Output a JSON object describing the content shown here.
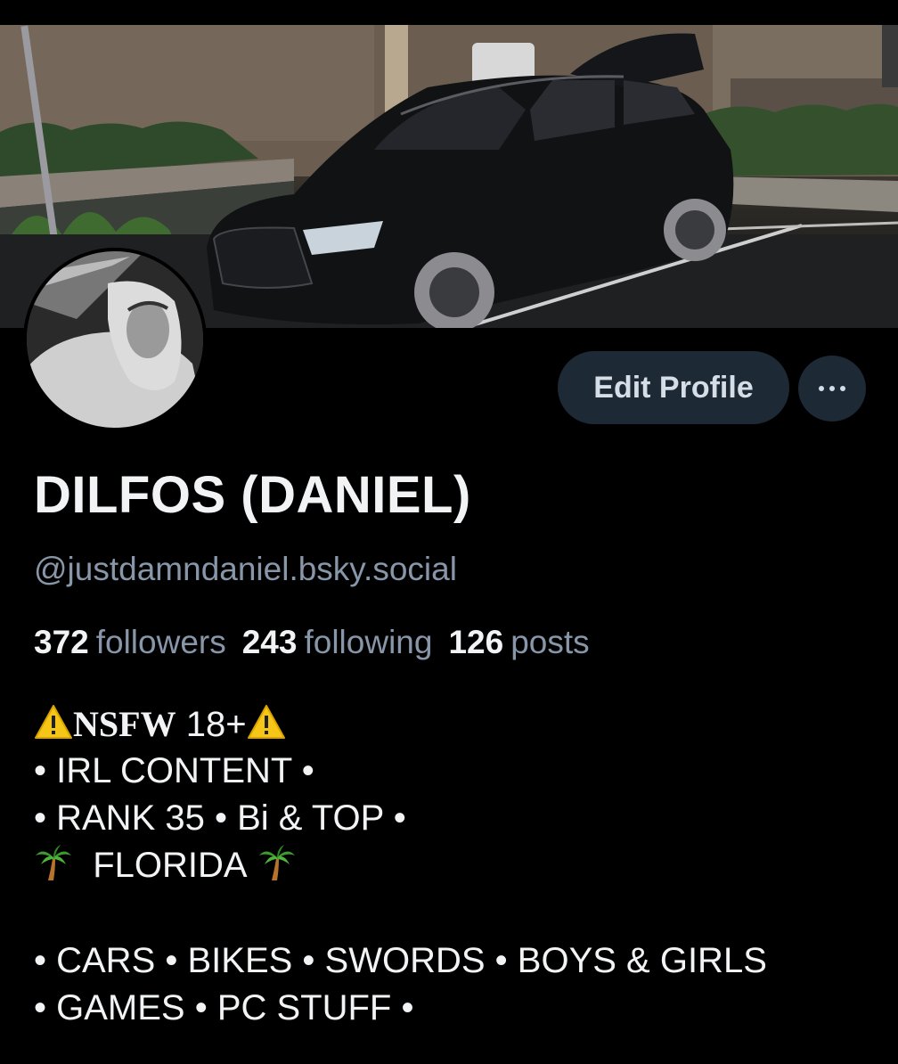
{
  "profile": {
    "display_name": "DILFOS (DANIEL)",
    "handle": "@justdamndaniel.bsky.social",
    "edit_button_label": "Edit Profile",
    "banner_description": "black-sedan-banner",
    "avatar_description": "hoodie-selfie-avatar"
  },
  "stats": [
    {
      "count": "372",
      "label": "followers"
    },
    {
      "count": "243",
      "label": "following"
    },
    {
      "count": "126",
      "label": "posts"
    }
  ],
  "bio": {
    "line1_nsfw": "NSFW",
    "line1_age": "18+",
    "line2": "• IRL CONTENT •",
    "line3": "• RANK 35 • Bi & TOP •",
    "line4": "FLORIDA",
    "line5": "• CARS • BIKES • SWORDS • BOYS & GIRLS",
    "line6": "• GAMES • PC STUFF •"
  },
  "colors": {
    "background": "#000000",
    "button_bg": "#1e2936",
    "muted_text": "#8796a8",
    "primary_text": "#f1f3f5"
  }
}
